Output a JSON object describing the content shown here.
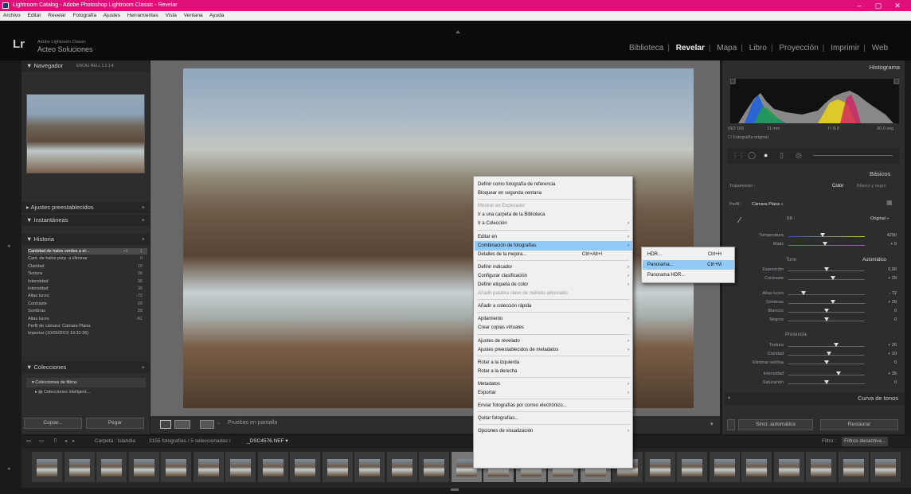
{
  "window": {
    "title": "Lightroom Catalog - Adobe Photoshop Lightroom Classic - Revelar",
    "minimize": "–",
    "maximize": "▢",
    "close": "✕"
  },
  "menubar": [
    "Archivo",
    "Editar",
    "Revelar",
    "Fotografía",
    "Ajustes",
    "Herramientas",
    "Vista",
    "Ventana",
    "Ayuda"
  ],
  "identity": {
    "logo": "Lr",
    "small": "Adobe Lightroom Classic",
    "name": "Acteo Soluciones"
  },
  "modules": {
    "items": [
      "Biblioteca",
      "Revelar",
      "Mapa",
      "Libro",
      "Proyección",
      "Imprimir",
      "Web"
    ],
    "active": "Revelar"
  },
  "left": {
    "navigator": {
      "title": "Navegador",
      "tabs": "ENCAJ  RELL  1:1  1:4"
    },
    "presets": {
      "title": "Ajustes preestablecidos",
      "action": "+"
    },
    "snapshots": {
      "title": "Instantáneas",
      "action": "+"
    },
    "history": {
      "title": "Historia",
      "action": "×",
      "rows": [
        {
          "label": "Cantidad de halos verdes a el...",
          "a": "+1",
          "b": "1",
          "selected": true
        },
        {
          "label": "Cant. de halos púrp. a eliminar",
          "a": "",
          "b": "0"
        },
        {
          "label": "Claridad",
          "a": "",
          "b": "10"
        },
        {
          "label": "Textura",
          "a": "",
          "b": "26"
        },
        {
          "label": "Intensidad",
          "a": "",
          "b": "35"
        },
        {
          "label": "Intensidad",
          "a": "",
          "b": "39"
        },
        {
          "label": "Altas luces",
          "a": "",
          "b": "-72"
        },
        {
          "label": "Contraste",
          "a": "",
          "b": "29"
        },
        {
          "label": "Sombras",
          "a": "",
          "b": "29"
        },
        {
          "label": "Altas luces",
          "a": "",
          "b": "-61"
        },
        {
          "label": "Perfil de cámara: Cámara Plana",
          "a": "",
          "b": ""
        },
        {
          "label": "Importar (10/09/2019 19:32:36)",
          "a": "",
          "b": ""
        }
      ]
    },
    "collections": {
      "title": "Colecciones",
      "action": "+",
      "items": [
        "Colecciones de filtros",
        "Colecciones inteligent..."
      ]
    },
    "copy": "Copiar...",
    "paste": "Pegar"
  },
  "toolbar": {
    "softproof": "Pruebas en pantalla"
  },
  "context_menu": {
    "items": [
      {
        "label": "Definir como fotografía de referencia"
      },
      {
        "label": "Bloquear en segunda ventana"
      },
      {
        "sep": true
      },
      {
        "label": "Mostrar en Explorador",
        "disabled": true
      },
      {
        "label": "Ir a una carpeta de la Biblioteca"
      },
      {
        "label": "Ir a Colección",
        "arrow": true
      },
      {
        "sep": true
      },
      {
        "label": "Editar en",
        "arrow": true
      },
      {
        "label": "Combinación de fotografías",
        "arrow": true,
        "highlight": true
      },
      {
        "label": "Detalles de la mejora...",
        "shortcut": "Ctrl+Alt+I"
      },
      {
        "sep": true
      },
      {
        "label": "Definir indicador",
        "arrow": true
      },
      {
        "label": "Configurar clasificación",
        "arrow": true
      },
      {
        "label": "Definir etiqueta de color",
        "arrow": true
      },
      {
        "label": "Añadir palabra clave de método abreviado",
        "disabled": true
      },
      {
        "sep": true
      },
      {
        "label": "Añadir a colección rápida"
      },
      {
        "sep": true
      },
      {
        "label": "Apilamiento",
        "arrow": true
      },
      {
        "label": "Crear copias virtuales"
      },
      {
        "sep": true
      },
      {
        "label": "Ajustes de revelado",
        "arrow": true
      },
      {
        "label": "Ajustes preestablecidos de metadatos",
        "arrow": true
      },
      {
        "sep": true
      },
      {
        "label": "Rotar a la izquierda"
      },
      {
        "label": "Rotar a la derecha"
      },
      {
        "sep": true
      },
      {
        "label": "Metadatos",
        "arrow": true
      },
      {
        "label": "Exportar",
        "arrow": true
      },
      {
        "sep": true
      },
      {
        "label": "Enviar fotografías por correo electrónico..."
      },
      {
        "sep": true
      },
      {
        "label": "Quitar fotografías..."
      },
      {
        "sep": true
      },
      {
        "label": "Opciones de visualización",
        "arrow": true
      }
    ]
  },
  "submenu": {
    "items": [
      {
        "label": "HDR...",
        "shortcut": "Ctrl+H"
      },
      {
        "label": "Panorama...",
        "shortcut": "Ctrl+M",
        "highlight": true
      },
      {
        "label": "Panorama HDR..."
      }
    ]
  },
  "right": {
    "histogram": {
      "title": "Histograma",
      "iso": "ISO 100",
      "focal": "11 mm",
      "aperture": "f / 8.0",
      "shutter": "30.0 seg",
      "original": "Fotografía original"
    },
    "basic": {
      "title": "Básicos",
      "treatment_label": "Tratamiento :",
      "color": "Color",
      "bw": "Blanco y negro",
      "profile_label": "Perfil :",
      "profile": "Cámara Plana ÷",
      "wb_label": "BB :",
      "wb": "Original ÷",
      "tone_label": "Tono",
      "auto": "Automático",
      "presence_label": "Presencia",
      "sliders": [
        {
          "label": "Temperatura",
          "value": "4250"
        },
        {
          "label": "Matiz",
          "value": "+ 9"
        },
        {
          "label": "Exposición",
          "value": "0,00"
        },
        {
          "label": "Contraste",
          "value": "+ 29"
        },
        {
          "label": "Altas luces",
          "value": "- 72"
        },
        {
          "label": "Sombras",
          "value": "+ 29"
        },
        {
          "label": "Blancos",
          "value": "0"
        },
        {
          "label": "Negros",
          "value": "0"
        },
        {
          "label": "Textura",
          "value": "+ 26"
        },
        {
          "label": "Claridad",
          "value": "+ 10"
        },
        {
          "label": "Eliminar neblina",
          "value": "0"
        },
        {
          "label": "Intensidad",
          "value": "+ 35"
        },
        {
          "label": "Saturación",
          "value": "0"
        }
      ]
    },
    "tone_curve": "Curva de tonos",
    "auto_sync": "Sincr. automática",
    "reset": "Restaurar"
  },
  "filmstrip": {
    "source": "Carpeta : Islandia",
    "count": "3155 fotografías / 5 seleccionadas /",
    "file": "_DSC4576.NEF ▾",
    "filter_label": "Filtro :",
    "filter": "Filtros desactiva..."
  }
}
